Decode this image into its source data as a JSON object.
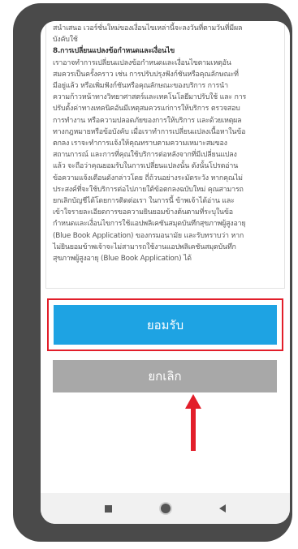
{
  "terms": {
    "lines_top": [
      "สนำเสนอ เวอร์ชั่นใหม่ของเงื่อนไขเหล่านี้จะลงวันที่ตามวันที่มีผล",
      "บังคับใช้"
    ],
    "heading": "8.การเปลี่ยนแปลงข้อกำหนดและเงื่อนไข",
    "body_lines": [
      "เราอาจทำการเปลี่ยนแปลงข้อกำหนดและเงื่อนไขตามเหตุอัน",
      "สมควรเป็นครั้งคราว เช่น การปรับปรุงฟังก์ชันหรือคุณลักษณะที่",
      "มีอยู่แล้ว หรือเพิ่มฟังก์ชันหรือคุณลักษณะของบริการ การนำ",
      "ความก้าวหน้าทางวิทยาศาสตร์และเทคโนโลยีมาปรับใช้ และ การ",
      "ปรับตั้งค่าทางเทคนิคอันมีเหตุสมควรแก่การให้บริการ ตรวจสอบ",
      "การทำงาน หรือความปลอดภัยของการให้บริการ และด้วยเหตุผล",
      "ทางกฎหมายหรือข้อบังคับ เมื่อเราทำการเปลี่ยนแปลงเนื้อหาในข้อ",
      "ตกลง เราจะทำการแจ้งให้คุณทราบตามความเหมาะสมของ",
      "สถานการณ์ และการที่คุณใช้บริการต่อหลังจากที่มีเปลี่ยนแปลง",
      "แล้ว จะถือว่าคุณยอมรับในการเปลี่ยนแปลงนั้น ดังนั้นโปรดอ่าน",
      "ข้อความแจ้งเตือนดังกล่าวโดย ถี่ถ้วนอย่างระมัดระวัง หากคุณไม่",
      "ประสงค์ที่จะใช้บริการต่อไปภายใต้ข้อตกลงฉบับใหม่ คุณสามารถ",
      "ยกเลิกบัญชีได้โดยการติดต่อเรา ในการนี้ ข้าพเจ้าได้อ่าน และ",
      "เข้าใจรายละเอียดการขอความยินยอมข้างต้นตามที่ระบุในข้อ",
      "กำหนดและเงื่อนไขการใช้แอปพลิเคชันสมุดบันทึกสุขภาพผู้สูงอายุ",
      "(Blue Book Application) ของกรมอนามัย และรับทราบว่า หาก",
      "ไม่ยินยอมข้าพเจ้าจะไม่สามารถใช้งานแอปพลิเคชันสมุดบันทึก",
      "สุขภาพผู้สูงอายุ (Blue Book Application) ได้"
    ]
  },
  "buttons": {
    "accept_label": "ยอมรับ",
    "cancel_label": "ยกเลิก"
  },
  "colors": {
    "accept": "#1ea3e3",
    "cancel": "#a8a8a8",
    "highlight": "#e21e2a"
  },
  "icons": {
    "nav_recent": "square-icon",
    "nav_home": "circle-icon",
    "nav_back": "triangle-back-icon",
    "pointer": "red-up-arrow-icon"
  }
}
